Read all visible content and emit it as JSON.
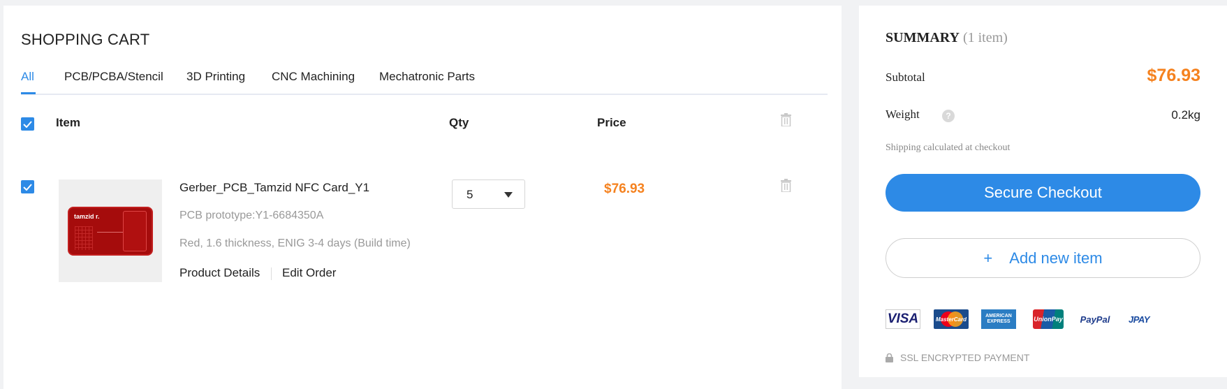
{
  "cart": {
    "title": "SHOPPING CART",
    "tabs": [
      {
        "label": "All",
        "active": true
      },
      {
        "label": "PCB/PCBA/Stencil",
        "active": false
      },
      {
        "label": "3D Printing",
        "active": false
      },
      {
        "label": "CNC Machining",
        "active": false
      },
      {
        "label": "Mechatronic Parts",
        "active": false
      }
    ],
    "columns": {
      "item": "Item",
      "qty": "Qty",
      "price": "Price"
    },
    "select_all_checked": true,
    "items": [
      {
        "checked": true,
        "thumbnail_text": "tamzid r.",
        "name": "Gerber_PCB_Tamzid NFC Card_Y1",
        "subtitle": "PCB prototype:Y1-6684350A",
        "description": "Red, 1.6 thickness, ENIG 3-4 days (Build time)",
        "links": {
          "details": "Product Details",
          "edit": "Edit Order"
        },
        "qty": "5",
        "price": "$76.93"
      }
    ]
  },
  "summary": {
    "title": "SUMMARY",
    "count": "(1 item)",
    "subtotal_label": "Subtotal",
    "subtotal_value": "$76.93",
    "weight_label": "Weight",
    "weight_help": "?",
    "weight_value": "0.2kg",
    "shipping_note": "Shipping calculated at checkout",
    "checkout_label": "Secure Checkout",
    "add_item_plus": "+",
    "add_item_label": "Add new item",
    "payment_methods": [
      {
        "name": "VISA",
        "icon": "visa-logo"
      },
      {
        "name": "MasterCard",
        "icon": "mastercard-logo"
      },
      {
        "name": "AMERICAN EXPRESS",
        "icon": "amex-logo"
      },
      {
        "name": "UnionPay",
        "icon": "unionpay-logo"
      },
      {
        "name": "PayPal",
        "icon": "paypal-logo"
      },
      {
        "name": "JPAY",
        "icon": "jpay-logo"
      }
    ],
    "ssl_label": "SSL ENCRYPTED PAYMENT"
  },
  "colors": {
    "accent": "#2d8ae6",
    "price": "#f5821f",
    "background": "#f1f2f4"
  }
}
